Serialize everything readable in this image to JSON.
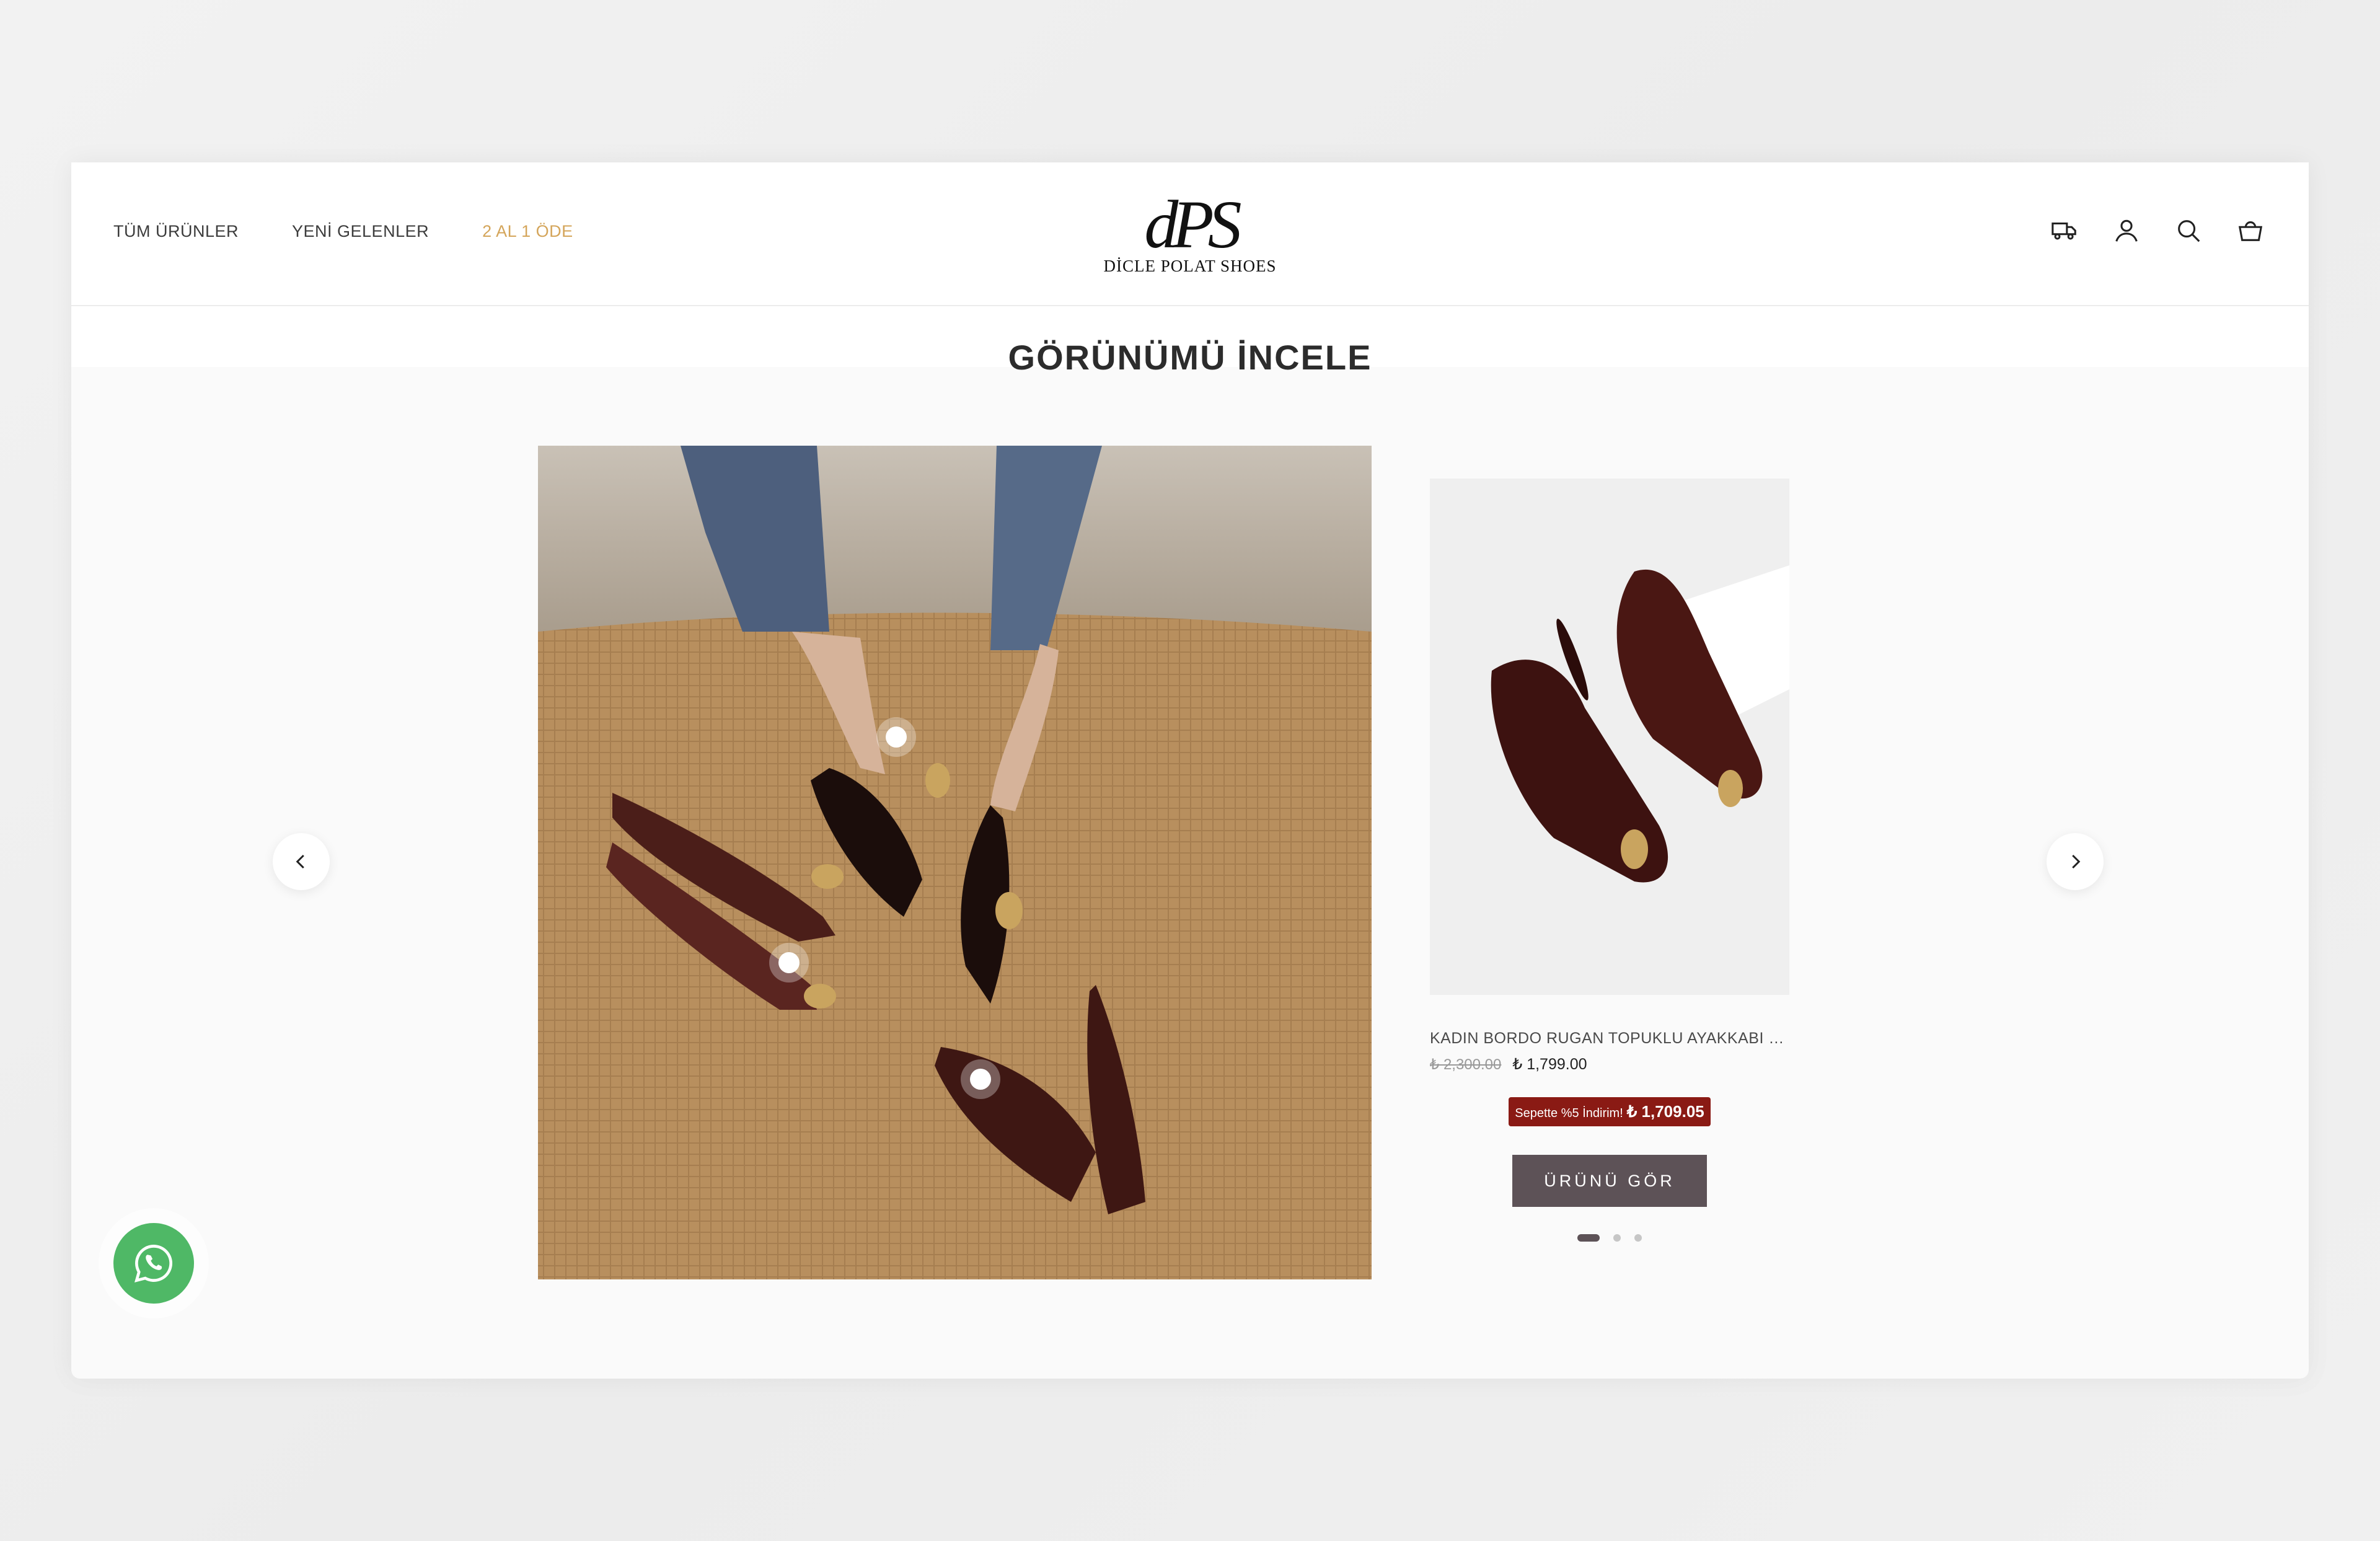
{
  "nav": {
    "items": [
      {
        "label": "TÜM ÜRÜNLER"
      },
      {
        "label": "YENİ GELENLER"
      },
      {
        "label": "2 AL 1 ÖDE",
        "color": "#d4a55a"
      }
    ]
  },
  "logo": {
    "mark": "dPS",
    "name": "DİCLE POLAT SHOES"
  },
  "header_icons": [
    "truck-icon",
    "account-icon",
    "search-icon",
    "cart-icon"
  ],
  "section": {
    "title": "GÖRÜNÜMÜ İNCELE"
  },
  "product": {
    "title": "KADIN BORDO RUGAN TOPUKLU AYAKKABI GOL...",
    "old_price": "₺ 2,300.00",
    "price": "₺ 1,799.00",
    "discount_label": "Sepette %5 İndirim!",
    "discount_price": "₺ 1,709.05",
    "cta": "ÜRÜNÜ GÖR"
  },
  "carousel": {
    "slides": 3,
    "active": 1
  },
  "colors": {
    "accent": "#d4a55a",
    "discount_bg": "#8a1a14",
    "button": "#5d5257",
    "whatsapp": "#4fb866"
  }
}
